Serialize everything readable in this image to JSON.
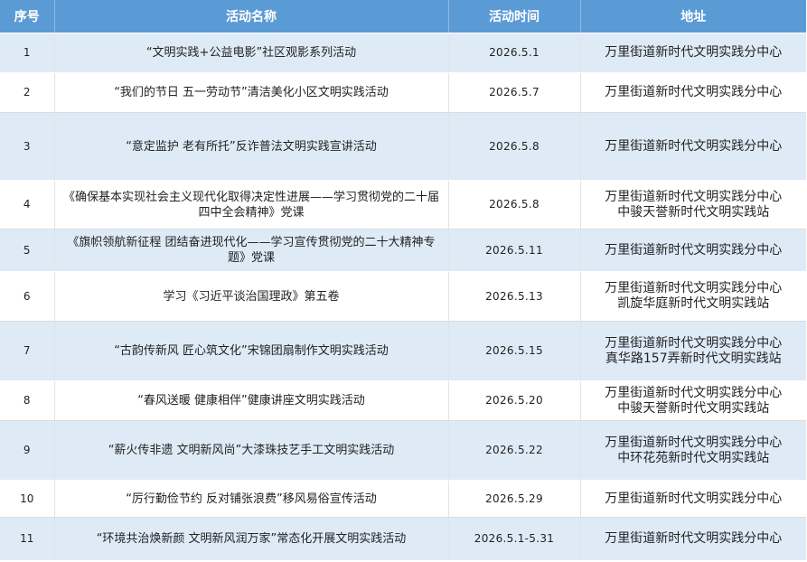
{
  "table": {
    "headers": {
      "no": "序号",
      "name": "活动名称",
      "time": "活动时间",
      "address": "地址"
    },
    "rows": [
      {
        "no": "1",
        "name": "“文明实践+公益电影”社区观影系列活动",
        "time": "2026.5.1",
        "address": [
          "万里街道新时代文明实践分中心"
        ]
      },
      {
        "no": "2",
        "name": "“我们的节日 五一劳动节”清洁美化小区文明实践活动",
        "time": "2026.5.7",
        "address": [
          "万里街道新时代文明实践分中心"
        ]
      },
      {
        "no": "3",
        "name": "“意定监护 老有所托”反诈普法文明实践宣讲活动",
        "time": "2026.5.8",
        "address": [
          "万里街道新时代文明实践分中心"
        ]
      },
      {
        "no": "4",
        "name": "《确保基本实现社会主义现代化取得决定性进展——学习贯彻党的二十届四中全会精神》党课",
        "time": "2026.5.8",
        "address": [
          "万里街道新时代文明实践分中心",
          "中骏天誉新时代文明实践站"
        ]
      },
      {
        "no": "5",
        "name": "《旗帜领航新征程 团结奋进现代化——学习宣传贯彻党的二十大精神专题》党课",
        "time": "2026.5.11",
        "address": [
          "万里街道新时代文明实践分中心"
        ]
      },
      {
        "no": "6",
        "name": "学习《习近平谈治国理政》第五卷",
        "time": "2026.5.13",
        "address": [
          "万里街道新时代文明实践分中心",
          "凯旋华庭新时代文明实践站"
        ]
      },
      {
        "no": "7",
        "name": "“古韵传新风 匠心筑文化”宋锦团扇制作文明实践活动",
        "time": "2026.5.15",
        "address": [
          "万里街道新时代文明实践分中心",
          "真华路157弄新时代文明实践站"
        ]
      },
      {
        "no": "8",
        "name": "“春风送暖 健康相伴”健康讲座文明实践活动",
        "time": "2026.5.20",
        "address": [
          "万里街道新时代文明实践分中心",
          "中骏天誉新时代文明实践站"
        ]
      },
      {
        "no": "9",
        "name": "“薪火传非遗 文明新风尚”大漆珠技艺手工文明实践活动",
        "time": "2026.5.22",
        "address": [
          "万里街道新时代文明实践分中心",
          "中环花苑新时代文明实践站"
        ]
      },
      {
        "no": "10",
        "name": "“厉行勤俭节约 反对铺张浪费”移风易俗宣传活动",
        "time": "2026.5.29",
        "address": [
          "万里街道新时代文明实践分中心"
        ]
      },
      {
        "no": "11",
        "name": "“环境共治焕新颜 文明新风润万家”常态化开展文明实践活动",
        "time": "2026.5.1-5.31",
        "address": [
          "万里街道新时代文明实践分中心"
        ]
      }
    ]
  },
  "colors": {
    "header_bg": "#5b9bd5",
    "header_text": "#ffffff",
    "stripe_bg": "#deebf7",
    "plain_bg": "#ffffff"
  }
}
